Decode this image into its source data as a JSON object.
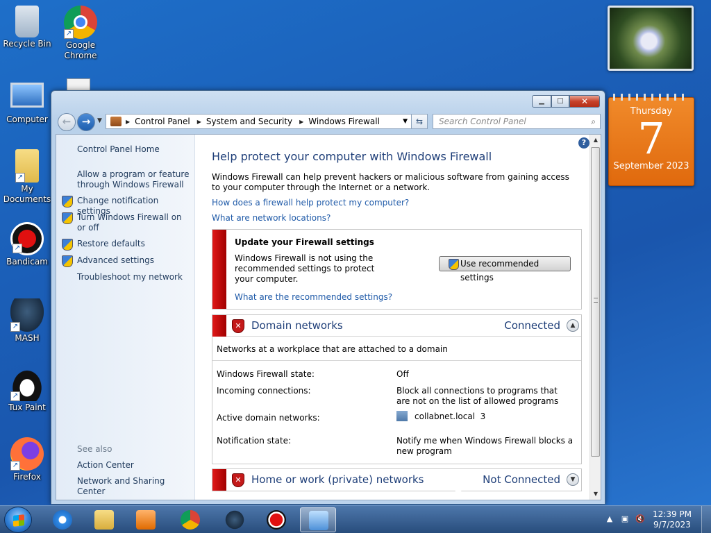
{
  "desktop": {
    "icons": [
      {
        "label": "Recycle Bin"
      },
      {
        "label": "Google Chrome"
      },
      {
        "label": "Computer"
      },
      {
        "label": "My Documents"
      },
      {
        "label": "Bandicam"
      },
      {
        "label": "MASH"
      },
      {
        "label": "Tux Paint"
      },
      {
        "label": "Firefox"
      }
    ]
  },
  "calendar_gadget": {
    "weekday": "Thursday",
    "day": "7",
    "month_year": "September 2023"
  },
  "window": {
    "address": {
      "crumbs": [
        "Control Panel",
        "System and Security",
        "Windows Firewall"
      ],
      "search_placeholder": "Search Control Panel"
    },
    "left_pane": {
      "home": "Control Panel Home",
      "items": [
        "Allow a program or feature through Windows Firewall",
        "Change notification settings",
        "Turn Windows Firewall on or off",
        "Restore defaults",
        "Advanced settings",
        "Troubleshoot my network"
      ],
      "see_also_label": "See also",
      "see_also": [
        "Action Center",
        "Network and Sharing Center"
      ]
    },
    "main": {
      "title": "Help protect your computer with Windows Firewall",
      "description": "Windows Firewall can help prevent hackers or malicious software from gaining access to your computer through the Internet or a network.",
      "links": [
        "How does a firewall help protect my computer?",
        "What are network locations?"
      ],
      "update": {
        "title": "Update your Firewall settings",
        "body": "Windows Firewall is not using the recommended settings to protect your computer.",
        "link": "What are the recommended settings?",
        "button": "Use recommended settings"
      },
      "domain": {
        "title": "Domain networks",
        "status": "Connected",
        "subtitle": "Networks at a workplace that are attached to a domain",
        "rows": [
          {
            "key": "Windows Firewall state:",
            "value": "Off"
          },
          {
            "key": "Incoming connections:",
            "value": "Block all connections to programs that are not on the list of allowed programs"
          },
          {
            "key": "Active domain networks:",
            "value": "collabnet.local  3"
          },
          {
            "key": "Notification state:",
            "value": "Notify me when Windows Firewall blocks a new program"
          }
        ]
      },
      "home": {
        "title": "Home or work (private) networks",
        "status": "Not Connected"
      }
    }
  },
  "taskbar": {
    "time": "12:39 PM",
    "date": "9/7/2023"
  },
  "colors": {
    "accent": "#1e3e78",
    "link": "#1f5aa8",
    "alert_red": "#c41a1a",
    "calendar_orange": "#e8781c"
  }
}
